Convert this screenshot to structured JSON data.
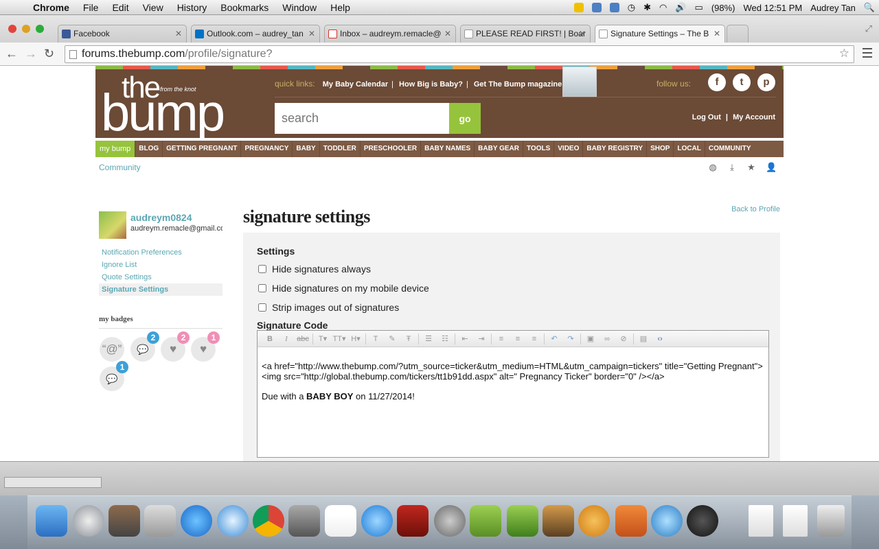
{
  "menubar": {
    "app": "Chrome",
    "items": [
      "File",
      "Edit",
      "View",
      "History",
      "Bookmarks",
      "Window",
      "Help"
    ],
    "battery": "(98%)",
    "clock": "Wed 12:51 PM",
    "user": "Audrey Tan"
  },
  "browser": {
    "tabs": [
      {
        "label": "Facebook",
        "color": "#3b5998"
      },
      {
        "label": "Outlook.com – audrey_tan",
        "color": "#0072c6"
      },
      {
        "label": "Inbox – audreym.remacle@",
        "color": "#d93025"
      },
      {
        "label": "PLEASE READ FIRST! | Boar",
        "color": "#ffffff"
      },
      {
        "label": "Signature Settings – The B",
        "color": "#ffffff"
      }
    ],
    "url_domain": "forums.thebump.com",
    "url_path": "/profile/signature?"
  },
  "site": {
    "logo_the": "the",
    "logo_bump": "bump",
    "logo_from": "from the knot",
    "quick_links_label": "quick links:",
    "quick_links": [
      "My Baby Calendar",
      "How Big is Baby?",
      "Get The Bump magazine >"
    ],
    "follow_us": "follow us:",
    "search_placeholder": "search",
    "go_label": "go",
    "logout": "Log Out",
    "account_sep": "|",
    "my_account": "My Account",
    "nav": [
      "my bump",
      "BLOG",
      "GETTING PREGNANT",
      "PREGNANCY",
      "BABY",
      "TODDLER",
      "PRESCHOOLER",
      "BABY NAMES",
      "BABY GEAR",
      "TOOLS",
      "VIDEO",
      "BABY REGISTRY",
      "SHOP",
      "LOCAL",
      "COMMUNITY"
    ],
    "community_crumb": "Community"
  },
  "profile": {
    "username": "audreym0824",
    "email": "audreym.remacle@gmail.com",
    "links": [
      "Notification Preferences",
      "Ignore List",
      "Quote Settings",
      "Signature Settings"
    ],
    "badges_title": "my badges",
    "badges": [
      {
        "glyph": "“@”",
        "count": ""
      },
      {
        "glyph": "💬",
        "count": "2",
        "color": "#3ea0d8"
      },
      {
        "glyph": "♥",
        "count": "2",
        "color": "#ef8fb5"
      },
      {
        "glyph": "♥",
        "count": "1",
        "color": "#ef8fb5"
      },
      {
        "glyph": "💬",
        "count": "1",
        "color": "#3ea0d8"
      }
    ]
  },
  "main": {
    "title": "signature settings",
    "back_link": "Back to Profile",
    "settings_label": "Settings",
    "checkboxes": [
      "Hide signatures always",
      "Hide signatures on my mobile device",
      "Strip images out of signatures"
    ],
    "signature_code_label": "Signature Code",
    "editor_line1": "<a href=\"http://www.thebump.com/?utm_source=ticker&utm_medium=HTML&utm_campaign=tickers\" title=\"Getting Pregnant\">",
    "editor_line2": "<img src=\"http://global.thebump.com/tickers/tt1b91dd.aspx\" alt=\" Pregnancy Ticker\" border=\"0\"  /></a>",
    "editor_due_prefix": "Due with a ",
    "editor_due_bold": "BABY BOY",
    "editor_due_suffix": " on 11/27/2014!"
  }
}
